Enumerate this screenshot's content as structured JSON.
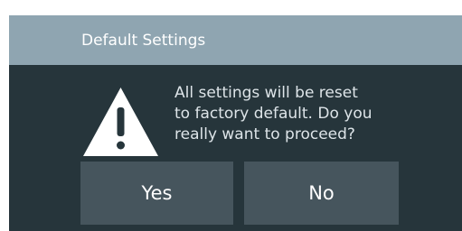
{
  "dialog": {
    "title": "Default Settings",
    "icon": "warning-icon",
    "message_lines": [
      "All settings will be reset",
      "to factory default. Do you",
      "really want to proceed?"
    ],
    "yes_label": "Yes",
    "no_label": "No"
  },
  "colors": {
    "titlebar": "#8fa5b1",
    "dialog_background": "#26353b",
    "button_background": "#46555d",
    "text": "#ffffff"
  }
}
